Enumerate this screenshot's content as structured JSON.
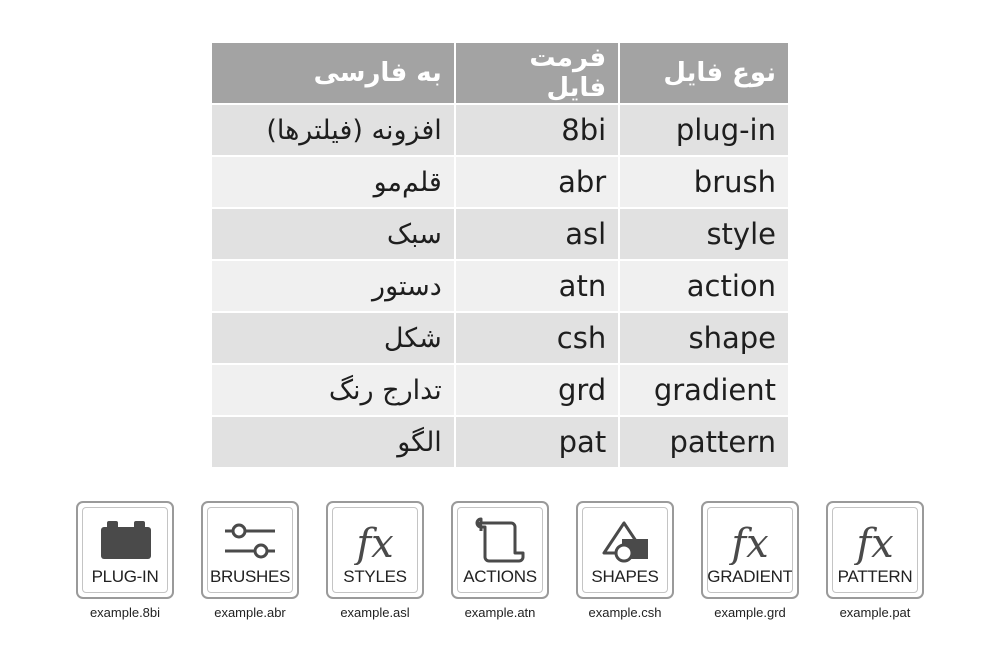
{
  "table": {
    "headers": {
      "type": "نوع فایل",
      "format": "فرمت فایل",
      "persian": "به فارسی"
    },
    "rows": [
      {
        "type": "plug-in",
        "format": "8bi",
        "persian": "افزونه (فیلترها)"
      },
      {
        "type": "brush",
        "format": "abr",
        "persian": "قلم‌مو"
      },
      {
        "type": "style",
        "format": "asl",
        "persian": "سبک"
      },
      {
        "type": "action",
        "format": "atn",
        "persian": "دستور"
      },
      {
        "type": "shape",
        "format": "csh",
        "persian": "شکل"
      },
      {
        "type": "gradient",
        "format": "grd",
        "persian": "تدارج رنگ"
      },
      {
        "type": "pattern",
        "format": "pat",
        "persian": "الگو"
      }
    ]
  },
  "icons": [
    {
      "icon": "plugin-block-icon",
      "label": "PLUG-IN",
      "file": "example.8bi"
    },
    {
      "icon": "sliders-icon",
      "label": "BRUSHES",
      "file": "example.abr"
    },
    {
      "icon": "fx-icon",
      "label": "STYLES",
      "file": "example.asl"
    },
    {
      "icon": "scroll-icon",
      "label": "ACTIONS",
      "file": "example.atn"
    },
    {
      "icon": "shapes-icon",
      "label": "SHAPES",
      "file": "example.csh"
    },
    {
      "icon": "fx-icon",
      "label": "GRADIENT",
      "file": "example.grd"
    },
    {
      "icon": "fx-icon",
      "label": "PATTERN",
      "file": "example.pat"
    }
  ],
  "colors": {
    "header_bg": "#a3a3a3",
    "row_odd": "#e1e1e1",
    "row_even": "#f0f0f0",
    "icon_fill": "#4a4a4a"
  }
}
